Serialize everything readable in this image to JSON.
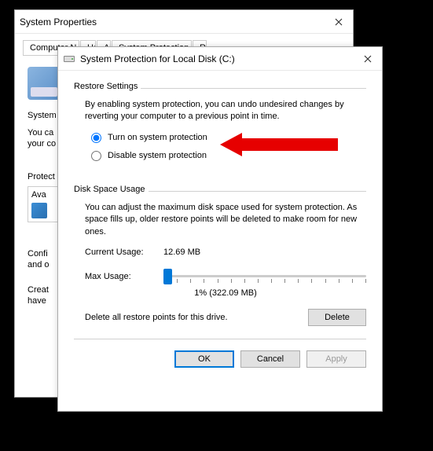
{
  "bg": {
    "title": "System Properties",
    "tabs": [
      "Computer N",
      "Ha",
      "A",
      "System Protection",
      "R"
    ],
    "section_label": "System",
    "desc_line1": "You ca",
    "desc_line2": "your co",
    "protect_label": "Protect",
    "ava_label": "Ava",
    "confi_line1": "Confi",
    "confi_line2": "and o",
    "creat_line1": "Creat",
    "creat_line2": "have"
  },
  "fg": {
    "title": "System Protection for Local Disk (C:)",
    "restore": {
      "legend": "Restore Settings",
      "desc": "By enabling system protection, you can undo undesired changes by reverting your computer to a previous point in time.",
      "opt_on": "Turn on system protection",
      "opt_off": "Disable system protection"
    },
    "disk": {
      "legend": "Disk Space Usage",
      "desc": "You can adjust the maximum disk space used for system protection. As space fills up, older restore points will be deleted to make room for new ones.",
      "current_label": "Current Usage:",
      "current_value": "12.69 MB",
      "max_label": "Max Usage:",
      "max_readout": "1% (322.09 MB)",
      "delete_desc": "Delete all restore points for this drive.",
      "delete_btn": "Delete"
    },
    "footer": {
      "ok": "OK",
      "cancel": "Cancel",
      "apply": "Apply"
    }
  }
}
